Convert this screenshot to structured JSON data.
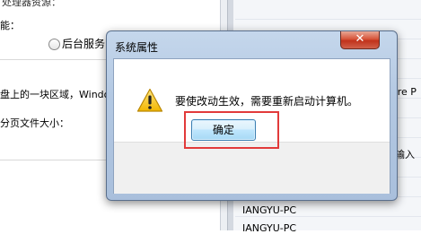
{
  "background": {
    "top_text": "处理器资源：",
    "perf_label": "能：",
    "radio_label": "后台服务",
    "vm_text": "盘上的一块区域，Windo",
    "page_text": "分页文件大小：",
    "right_profile_text": "ore P",
    "right_input_text": "输入",
    "pc_row_1": "IANGYU-PC",
    "pc_row_2": "IANGYU-PC"
  },
  "dialog": {
    "title": "系统属性",
    "close_symbol": "✕",
    "message": "要使改动生效，需要重新启动计算机。",
    "ok_label": "确定",
    "icon": "warning-icon"
  },
  "colors": {
    "highlight": "#e23a3a",
    "close_button": "#c7432b",
    "title_bar": "#b9cde6"
  }
}
